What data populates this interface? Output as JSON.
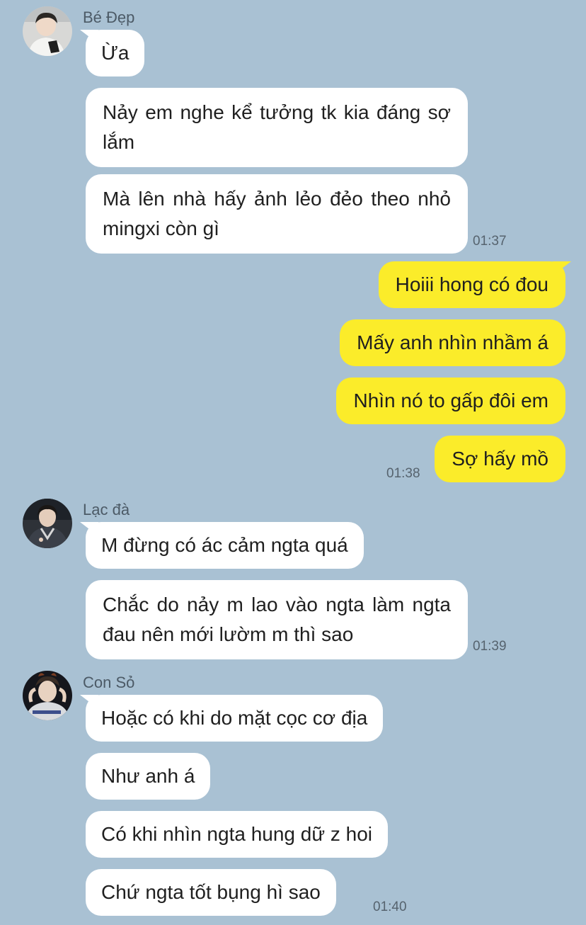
{
  "senders": {
    "be_dep": {
      "name": "Bé Đẹp"
    },
    "lac_da": {
      "name": "Lạc đà"
    },
    "con_so": {
      "name": "Con Sỏ"
    }
  },
  "messages": [
    {
      "from": "be_dep",
      "direction": "incoming",
      "text": "Ừa"
    },
    {
      "from": "be_dep",
      "direction": "incoming",
      "text": "Nảy em nghe kể tưởng tk kia đáng sợ lắm"
    },
    {
      "from": "be_dep",
      "direction": "incoming",
      "text": "Mà lên nhà hấy ảnh lẻo đẻo theo nhỏ mingxi còn gì",
      "time": "01:37"
    },
    {
      "from": "me",
      "direction": "outgoing",
      "text": "Hoiii hong có đou"
    },
    {
      "from": "me",
      "direction": "outgoing",
      "text": "Mấy anh nhìn nhầm á"
    },
    {
      "from": "me",
      "direction": "outgoing",
      "text": "Nhìn nó to gấp đôi em"
    },
    {
      "from": "me",
      "direction": "outgoing",
      "text": "Sợ hấy mồ",
      "time": "01:38"
    },
    {
      "from": "lac_da",
      "direction": "incoming",
      "text": "M đừng có ác cảm ngta quá"
    },
    {
      "from": "lac_da",
      "direction": "incoming",
      "text": "Chắc do nảy m lao vào ngta làm ngta đau nên mới lườm m thì sao",
      "time": "01:39"
    },
    {
      "from": "con_so",
      "direction": "incoming",
      "text": "Hoặc có khi do mặt cọc cơ địa"
    },
    {
      "from": "con_so",
      "direction": "incoming",
      "text": "Như anh á"
    },
    {
      "from": "con_so",
      "direction": "incoming",
      "text": "Có khi nhìn ngta hung dữ z hoi"
    },
    {
      "from": "con_so",
      "direction": "incoming",
      "text": "Chứ ngta tốt bụng hì sao",
      "time": "01:40"
    }
  ],
  "theme": {
    "background": "#a9c1d3",
    "incoming_bubble": "#ffffff",
    "outgoing_bubble": "#fbec2a"
  },
  "icons": [
    "avatar-be-dep",
    "avatar-lac-da",
    "avatar-con-so"
  ]
}
